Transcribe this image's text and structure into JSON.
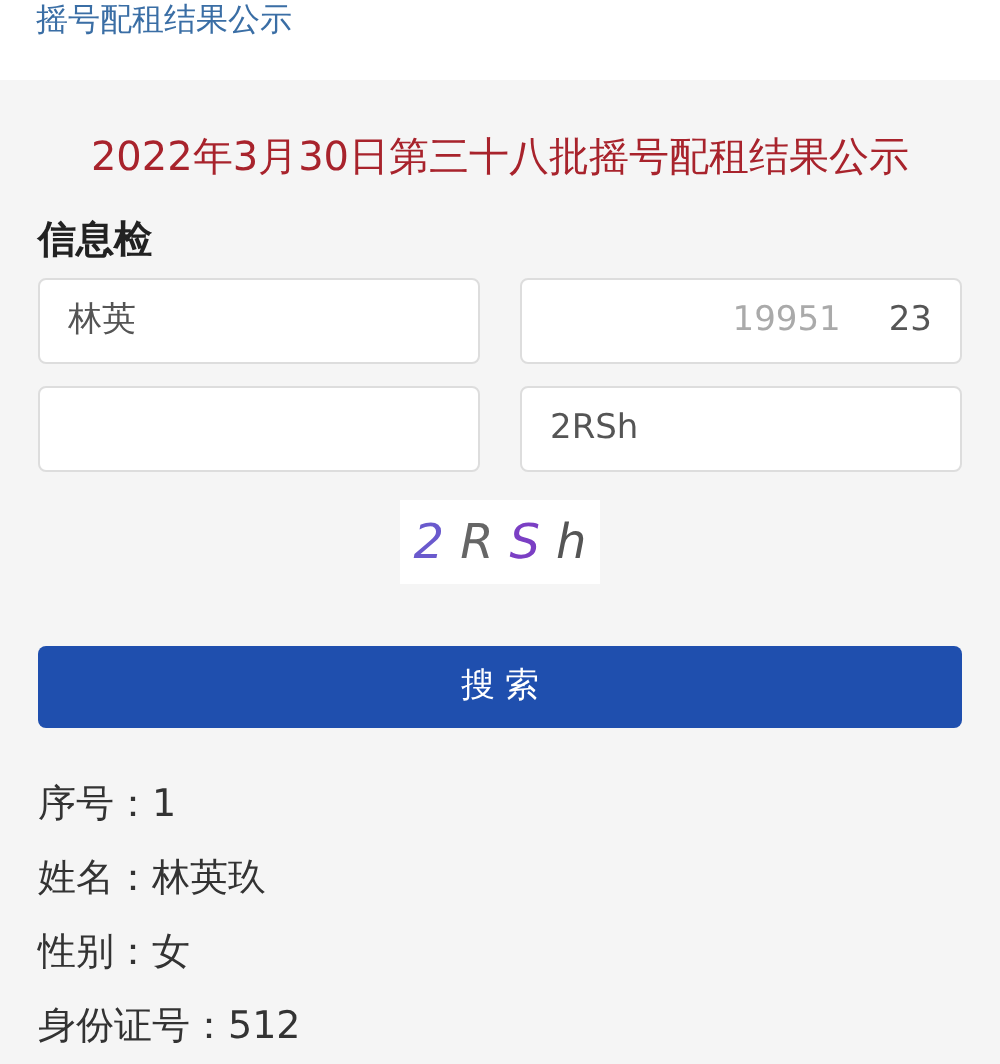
{
  "header": {
    "title": "摇号配租结果公示"
  },
  "notice_title": "2022年3月30日第三十八批摇号配租结果公示",
  "search": {
    "heading": "信息检",
    "fields": [
      {
        "kind": "text",
        "value": "林英"
      },
      {
        "kind": "partial",
        "fragments": [
          "19951",
          "23"
        ]
      },
      {
        "kind": "empty"
      },
      {
        "kind": "text",
        "value": "2RSh"
      }
    ],
    "captcha": [
      "2",
      "R",
      "S",
      "h"
    ],
    "button": "搜 索"
  },
  "result": [
    {
      "label": "序号：",
      "value": "1"
    },
    {
      "label": "姓名：",
      "value": "林英玖"
    },
    {
      "label": "性别：",
      "value": "女"
    },
    {
      "label": "身份证号：",
      "value": "512"
    }
  ]
}
